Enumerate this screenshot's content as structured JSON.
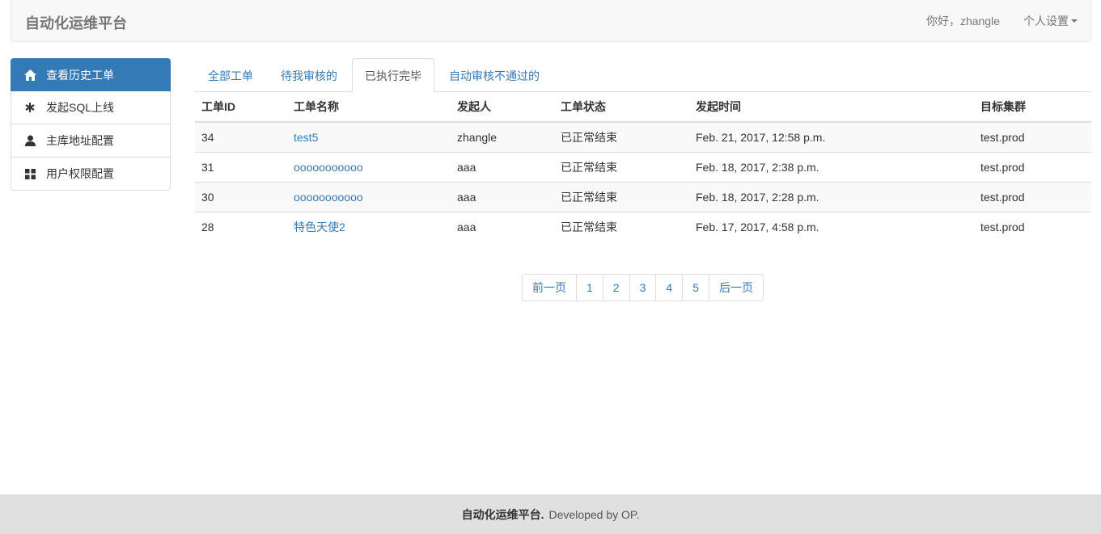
{
  "navbar": {
    "brand": "自动化运维平台",
    "greeting": "你好，zhangle",
    "settings_label": "个人设置"
  },
  "sidebar": {
    "items": [
      {
        "label": "查看历史工单",
        "icon": "home-icon",
        "active": true
      },
      {
        "label": "发起SQL上线",
        "icon": "asterisk-icon",
        "active": false
      },
      {
        "label": "主库地址配置",
        "icon": "user-icon",
        "active": false
      },
      {
        "label": "用户权限配置",
        "icon": "grid-icon",
        "active": false
      }
    ]
  },
  "tabs": [
    {
      "label": "全部工单",
      "active": false
    },
    {
      "label": "待我审核的",
      "active": false
    },
    {
      "label": "已执行完毕",
      "active": true
    },
    {
      "label": "自动审核不通过的",
      "active": false
    }
  ],
  "table": {
    "headers": [
      "工单ID",
      "工单名称",
      "发起人",
      "工单状态",
      "发起时间",
      "目标集群"
    ],
    "rows": [
      [
        "34",
        "test5",
        "zhangle",
        "已正常结束",
        "Feb. 21, 2017, 12:58 p.m.",
        "test.prod"
      ],
      [
        "31",
        "ooooooooooo",
        "aaa",
        "已正常结束",
        "Feb. 18, 2017, 2:38 p.m.",
        "test.prod"
      ],
      [
        "30",
        "ooooooooooo",
        "aaa",
        "已正常结束",
        "Feb. 18, 2017, 2:28 p.m.",
        "test.prod"
      ],
      [
        "28",
        "特色天使2",
        "aaa",
        "已正常结束",
        "Feb. 17, 2017, 4:58 p.m.",
        "test.prod"
      ]
    ]
  },
  "pagination": {
    "prev": "前一页",
    "pages": [
      "1",
      "2",
      "3",
      "4",
      "5"
    ],
    "next": "后一页"
  },
  "footer": {
    "brand": "自动化运维平台.",
    "text": "Developed by OP."
  },
  "colors": {
    "primary": "#337ab7",
    "navbar_bg": "#f8f8f8",
    "footer_bg": "#e0e0e0"
  }
}
